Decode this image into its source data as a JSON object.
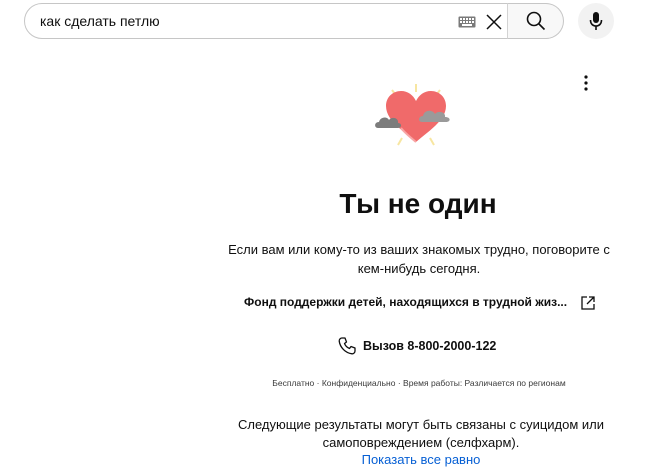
{
  "search": {
    "value": "как сделать петлю"
  },
  "crisis": {
    "title": "Ты не один",
    "description": "Если вам или кому-то из ваших знакомых трудно, поговорите с кем-нибудь сегодня.",
    "org_name": "Фонд поддержки детей, находящихся в трудной жиз...",
    "call_label": "Вызов 8-800-2000-122",
    "footnote": "Бесплатно · Конфиденциально · Время работы: Различается по регионам"
  },
  "notice": {
    "text": "Следующие результаты могут быть связаны с суицидом или самоповреждением (селфхарм).",
    "show_link": "Показать все равно"
  },
  "icons": {
    "keyboard": "keyboard-icon",
    "clear": "close-icon",
    "search": "search-icon",
    "mic": "microphone-icon",
    "menu": "more-vertical-icon",
    "external": "external-link-icon",
    "phone": "phone-icon",
    "illustration": "heart-clouds-illustration"
  },
  "colors": {
    "link": "#065fd4",
    "heart": "#f06a6a",
    "cloud": "#8a8a8a"
  }
}
